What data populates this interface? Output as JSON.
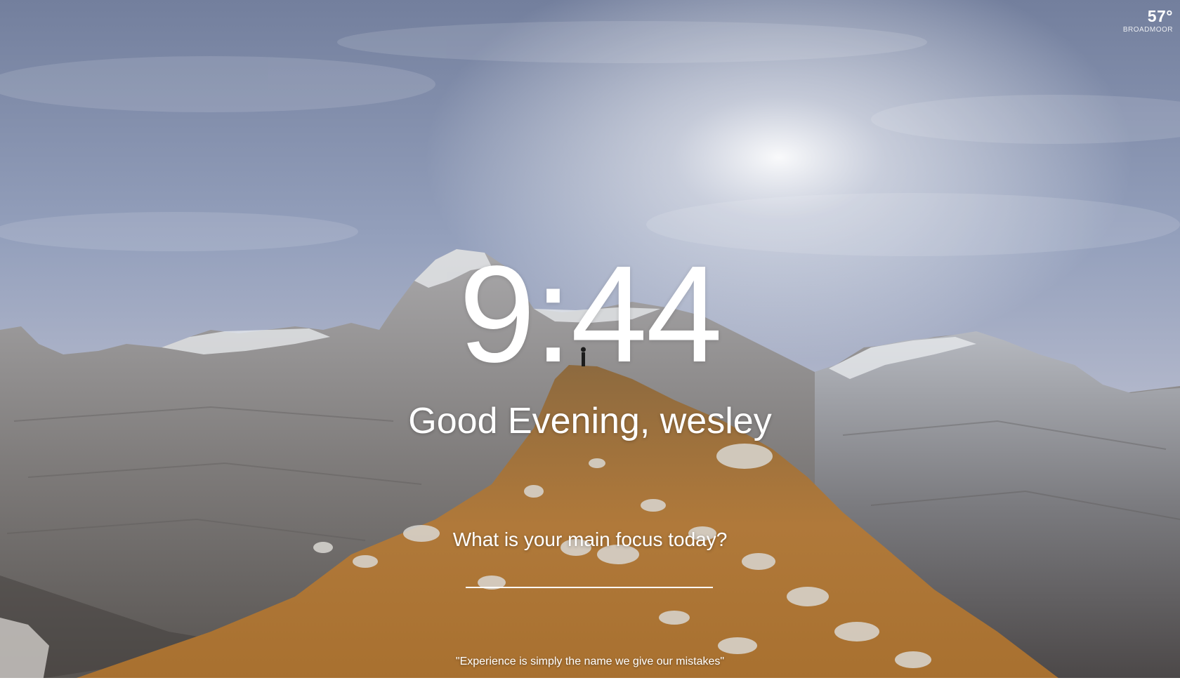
{
  "weather": {
    "temperature": "57°",
    "location": "BROADMOOR"
  },
  "clock": {
    "time": "9:44"
  },
  "greeting": {
    "text": "Good Evening, wesley"
  },
  "focus": {
    "question": "What is your main focus today?",
    "value": ""
  },
  "quote": {
    "text": "\"Experience is simply the name we give our mistakes\""
  },
  "background": {
    "scene": "mountain-ridge-landscape",
    "sky_color": "#8e9ab6",
    "grass_color": "#b07a3a",
    "rock_color": "#8a8886"
  }
}
